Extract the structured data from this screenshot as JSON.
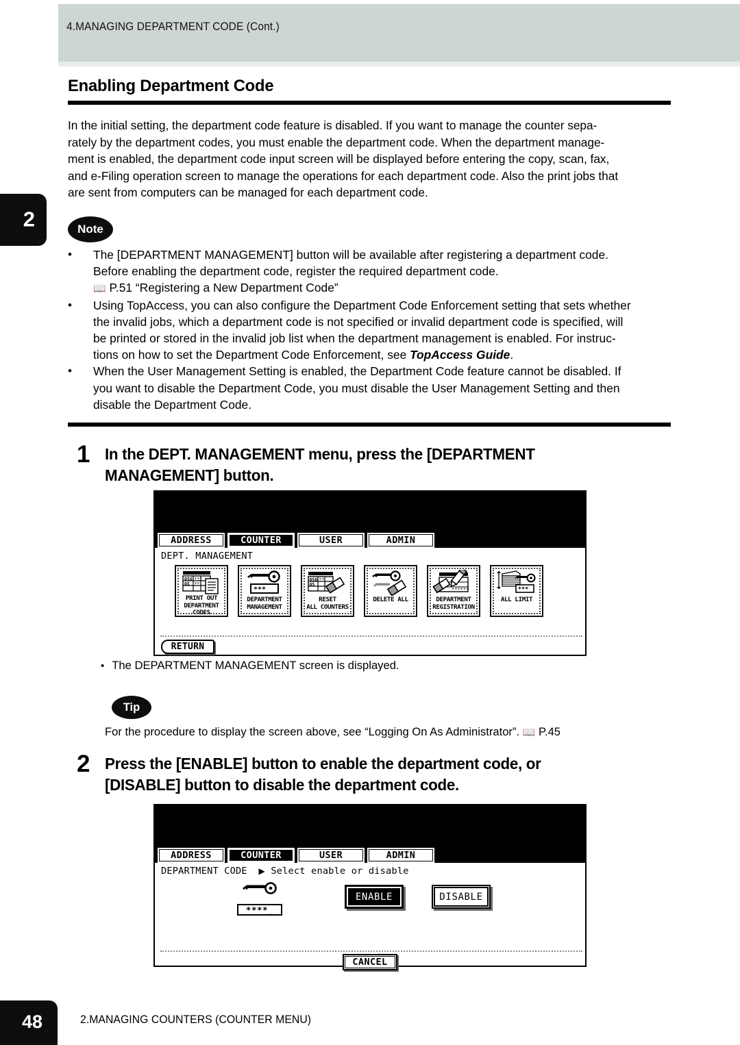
{
  "running_header": {
    "text": "4.MANAGING DEPARTMENT CODE (Cont.)"
  },
  "chapter_tab": {
    "number": "2"
  },
  "section": {
    "title": "Enabling Department Code",
    "paragraph_lines": [
      "In the initial setting, the department code feature is disabled.  If you want to manage the counter sepa-",
      "rately by the department codes, you must enable the department code.  When the department manage-",
      "ment is enabled, the department code input screen will be displayed before entering the copy, scan, fax,",
      "and e-Filing operation screen to manage the operations for each department code.  Also the print jobs that",
      "are sent from computers can be managed for each department code."
    ]
  },
  "note": {
    "badge": "Note",
    "bullets": [
      {
        "lines": [
          "The [DEPARTMENT MANAGEMENT] button will be available after registering a department code.",
          "Before enabling the department code, register the required department code."
        ],
        "reference": {
          "icon": "book-icon",
          "text": "P.51 “Registering a New Department Code”"
        }
      },
      {
        "lines": [
          "Using TopAccess, you can also configure the Department Code Enforcement setting that sets whether",
          "the invalid jobs, which a department code is not specified or invalid department code is specified, will",
          "be printed or stored in the invalid job list when the department management is enabled. For instruc-",
          "tions on how to set the Department Code Enforcement, see "
        ],
        "emphasis": "TopAccess Guide",
        "trailing": "."
      },
      {
        "lines": [
          "When the User Management Setting is enabled, the Department Code feature cannot be disabled. If",
          "you want to disable the Department Code, you must disable the User Management Setting and then",
          "disable the Department Code."
        ]
      }
    ]
  },
  "steps": [
    {
      "number": "1",
      "lines": [
        "In the DEPT. MANAGEMENT menu, press the [DEPARTMENT",
        "MANAGEMENT] button."
      ]
    },
    {
      "number": "2",
      "lines": [
        "Press the [ENABLE] button to enable the department code, or",
        "[DISABLE] button to disable the department code."
      ]
    }
  ],
  "screen1": {
    "tabs": [
      {
        "label": "ADDRESS",
        "selected": false
      },
      {
        "label": "COUNTER",
        "selected": true
      },
      {
        "label": "USER",
        "selected": false
      },
      {
        "label": "ADMIN",
        "selected": false
      }
    ],
    "breadcrumb": "DEPT. MANAGEMENT",
    "buttons": [
      {
        "icon": "printout-codes-icon",
        "label_line1": "PRINT OUT",
        "label_line2": "DEPARTMENT CODES"
      },
      {
        "icon": "key-password-icon",
        "label_line1": "DEPARTMENT",
        "label_line2": "MANAGEMENT"
      },
      {
        "icon": "counter-eraser-icon",
        "label_line1": "RESET",
        "label_line2": "ALL COUNTERS"
      },
      {
        "icon": "key-eraser-icon",
        "label_line1": "DELETE ALL",
        "label_line2": ""
      },
      {
        "icon": "registration-pencil-icon",
        "label_line1": "DEPARTMENT",
        "label_line2": "REGISTRATION"
      },
      {
        "icon": "stack-key-icon",
        "label_line1": "ALL LIMIT",
        "label_line2": ""
      }
    ],
    "return_label": "RETURN"
  },
  "caption_screen1": {
    "bullet": "•",
    "text": "The DEPARTMENT MANAGEMENT screen is displayed."
  },
  "tip": {
    "badge": "Tip",
    "text_before": "For the procedure to display the screen above, see “Logging On As Administrator”.",
    "reference_icon": "book-icon",
    "reference": "P.45"
  },
  "screen2": {
    "tabs": [
      {
        "label": "ADDRESS",
        "selected": false
      },
      {
        "label": "COUNTER",
        "selected": true
      },
      {
        "label": "USER",
        "selected": false
      },
      {
        "label": "ADMIN",
        "selected": false
      }
    ],
    "breadcrumb_label": "DEPARTMENT CODE",
    "breadcrumb_arrow": "▶",
    "breadcrumb_value": "Select enable or disable",
    "key_field_value": "****_",
    "enable_label": "ENABLE",
    "disable_label": "DISABLE",
    "enable_selected": true,
    "cancel_label": "CANCEL"
  },
  "footer": {
    "page_number": "48",
    "text": "2.MANAGING COUNTERS (COUNTER MENU)"
  },
  "colors": {
    "header_band": "#ced6d4",
    "tab_black": "#0d0d0d",
    "page_bg": "#ffffff"
  }
}
